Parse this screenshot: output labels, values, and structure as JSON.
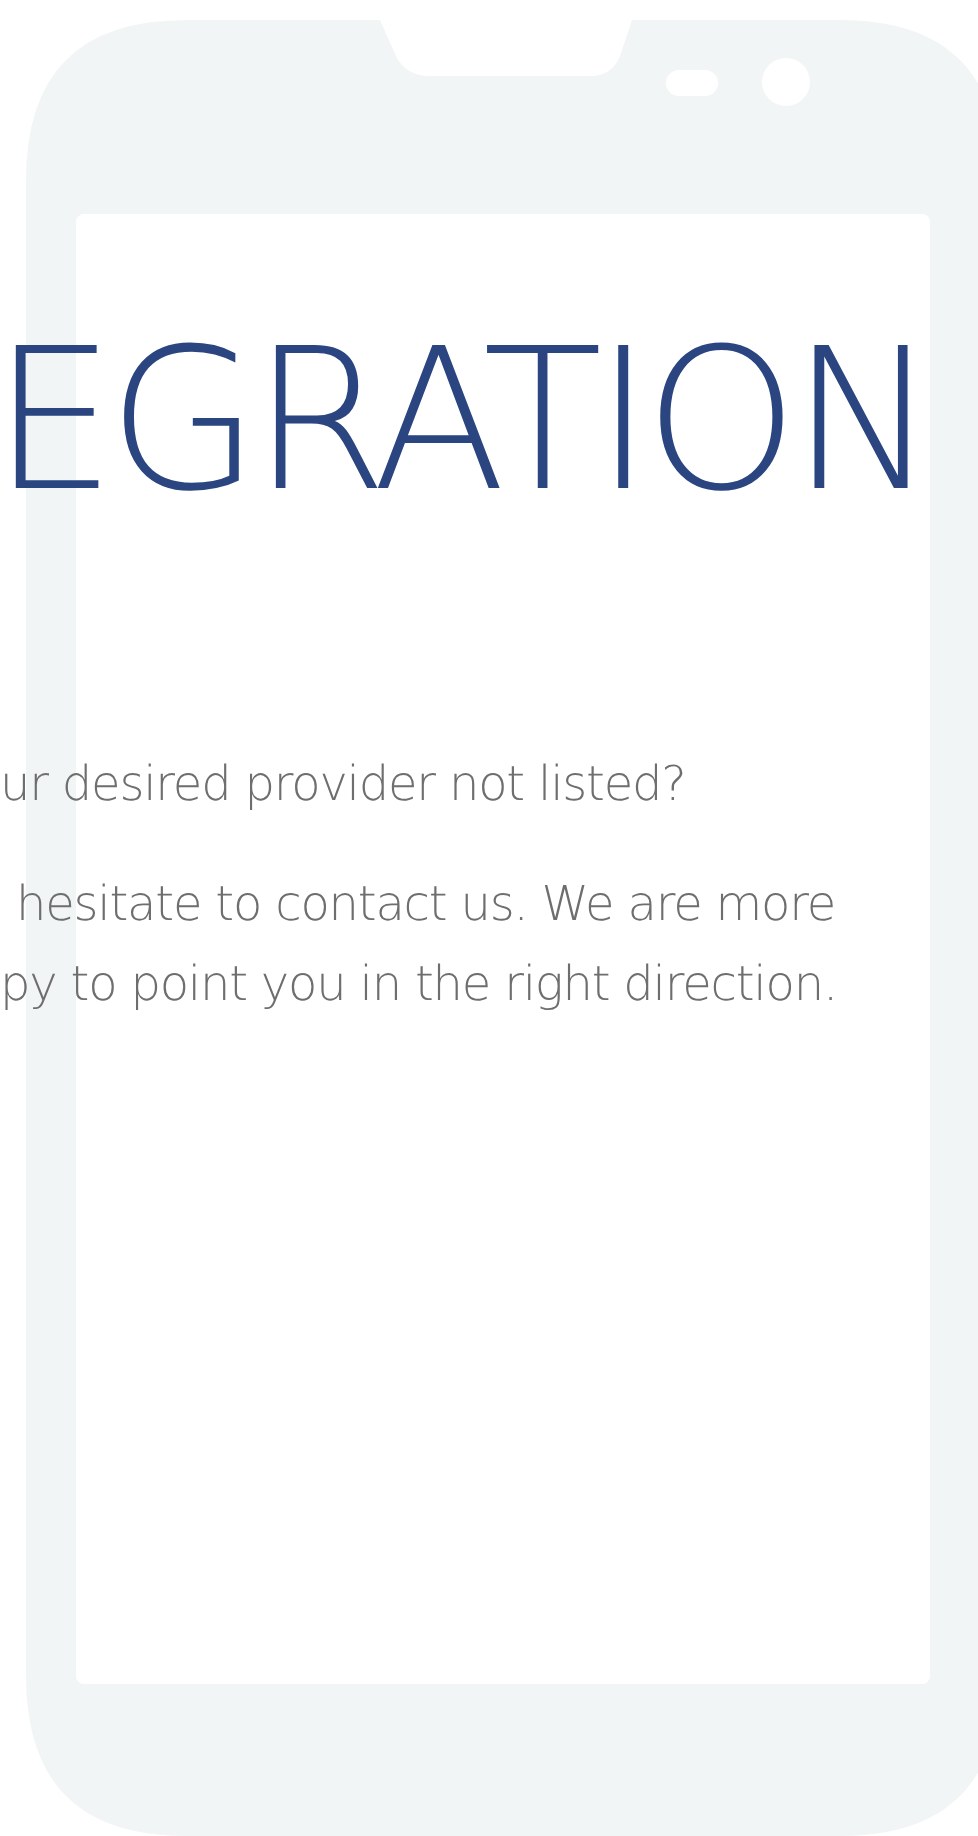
{
  "heading": "EGRATION",
  "question": "ur desired provider not listed?",
  "paragraph": {
    "lines": [
      "hesitate to contact us. We are more",
      "py to point you in the right direction."
    ]
  }
}
